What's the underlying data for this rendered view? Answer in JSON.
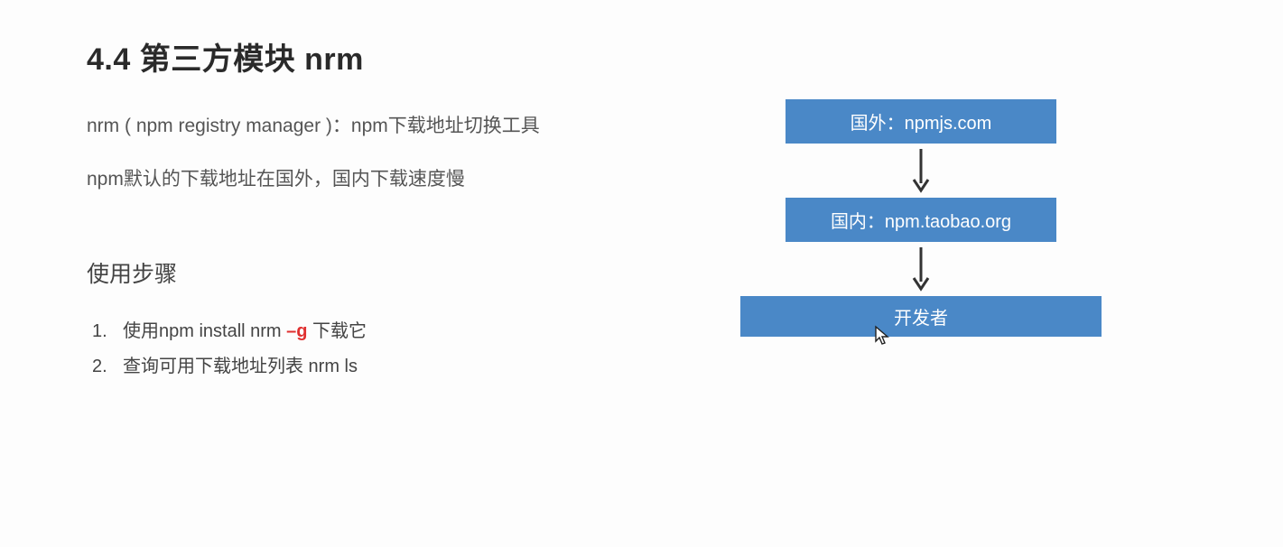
{
  "title": "4.4 第三方模块 nrm",
  "subtitle1": "nrm ( npm registry manager )：npm下载地址切换工具",
  "subtitle2": "npm默认的下载地址在国外，国内下载速度慢",
  "steps_title": "使用步骤",
  "steps": [
    {
      "num": "1.",
      "before": "使用npm install nrm ",
      "flag": "–g",
      "after": " 下载它"
    },
    {
      "num": "2.",
      "before": "查询可用下载地址列表 nrm ls",
      "flag": "",
      "after": ""
    }
  ],
  "diagram": {
    "box1": "国外：npmjs.com",
    "box2": "国内：npm.taobao.org",
    "box3": "开发者"
  }
}
